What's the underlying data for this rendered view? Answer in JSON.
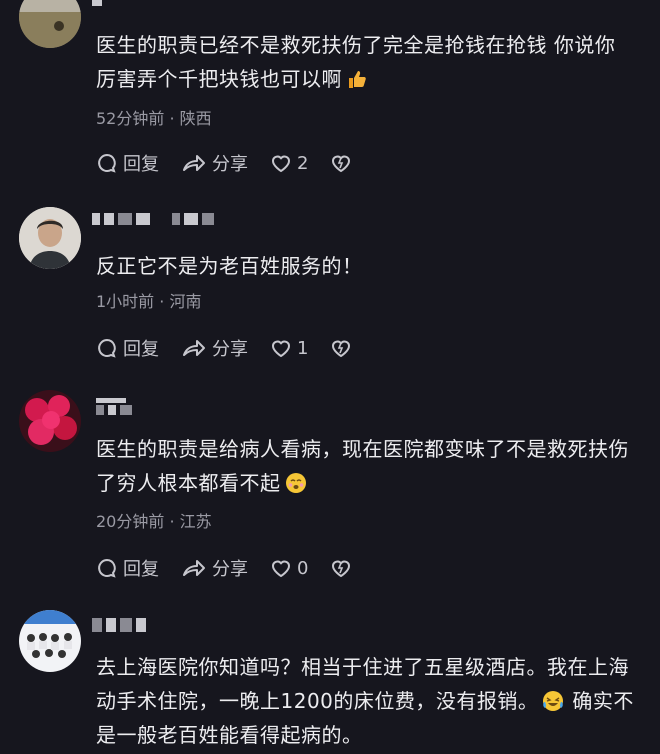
{
  "comments": [
    {
      "text_line1": "医生的职责已经不是救死扶伤了完全是抢钱在抢钱 你说你",
      "text_line2": "厉害弄个千把块钱也可以啊",
      "emoji": "thumbs-up-icon",
      "meta": "52分钟前 · 陕西",
      "reply_label": "回复",
      "share_label": "分享",
      "like_count": "2"
    },
    {
      "text_line1": "反正它不是为老百姓服务的！",
      "meta": "1小时前 · 河南",
      "reply_label": "回复",
      "share_label": "分享",
      "like_count": "1"
    },
    {
      "text_line1": "医生的职责是给病人看病，现在医院都变味了不是救死扶伤",
      "text_line2": "了穷人根本都看不起",
      "emoji": "relieved-face-icon",
      "meta": "20分钟前 · 江苏",
      "reply_label": "回复",
      "share_label": "分享",
      "like_count": "0"
    },
    {
      "text_line1": "去上海医院你知道吗？相当于住进了五星级酒店。我在上海",
      "text_line2": "动手术住院，一晚上1200的床位费，没有报销。",
      "text_line2b": "确实不",
      "text_line3": "是一般老百姓能看得起病的。",
      "emoji": "laughing-tears-icon"
    }
  ],
  "colors": {
    "background": "#16161e",
    "text": "#ededf0",
    "meta": "#9a9aa4",
    "thumbs": "#f4b13a"
  }
}
